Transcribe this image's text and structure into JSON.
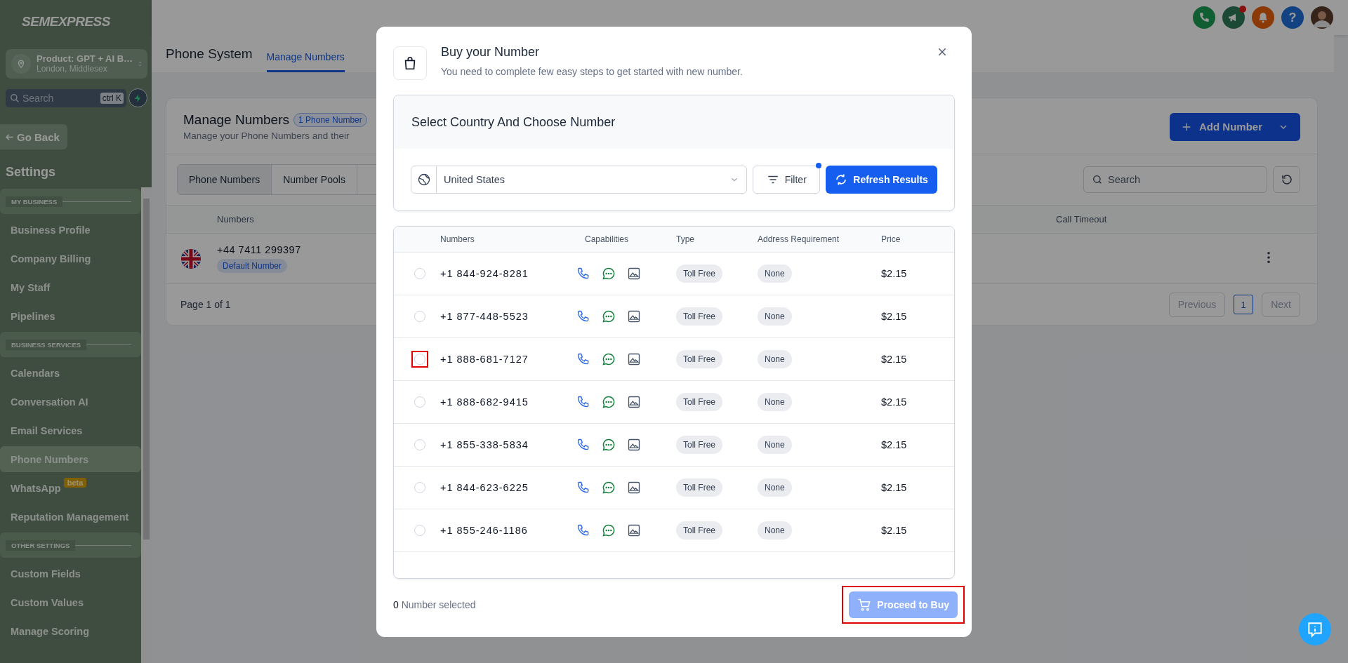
{
  "sidebar": {
    "logo_text": "SEMEXPRESS",
    "location": {
      "title": "Product: GPT + AI B…",
      "subtitle": "London, Middlesex"
    },
    "search": {
      "placeholder": "Search",
      "shortcut": "ctrl K"
    },
    "back": "Go Back",
    "heading": "Settings",
    "groups": [
      {
        "title": "MY BUSINESS",
        "items": [
          {
            "label": "Business Profile",
            "selected": false
          },
          {
            "label": "Company Billing",
            "selected": false
          },
          {
            "label": "My Staff",
            "selected": false
          },
          {
            "label": "Pipelines",
            "selected": false
          }
        ]
      },
      {
        "title": "BUSINESS SERVICES",
        "items": [
          {
            "label": "Calendars",
            "selected": false
          },
          {
            "label": "Conversation AI",
            "selected": false
          },
          {
            "label": "Email Services",
            "selected": false
          },
          {
            "label": "Phone Numbers",
            "selected": true
          },
          {
            "label": "WhatsApp",
            "selected": false,
            "badge": "beta"
          },
          {
            "label": "Reputation Management",
            "selected": false
          }
        ]
      },
      {
        "title": "OTHER SETTINGS",
        "items": [
          {
            "label": "Custom Fields",
            "selected": false
          },
          {
            "label": "Custom Values",
            "selected": false
          },
          {
            "label": "Manage Scoring",
            "selected": false
          }
        ]
      }
    ]
  },
  "topbar": {
    "actions": [
      {
        "kind": "phone"
      },
      {
        "kind": "megaphone",
        "alert": true
      },
      {
        "kind": "bell"
      },
      {
        "kind": "help",
        "label": "?"
      },
      {
        "kind": "avatar"
      }
    ]
  },
  "page": {
    "title": "Phone System",
    "tabs": [
      {
        "label": "Manage Numbers",
        "selected": true
      }
    ]
  },
  "card": {
    "title": "Manage Numbers",
    "count_badge": "1 Phone Number",
    "subtitle": "Manage your Phone Numbers and their",
    "add_button": "Add Number",
    "tabs": [
      {
        "label": "Phone Numbers",
        "selected": true
      },
      {
        "label": "Number Pools",
        "selected": false
      }
    ],
    "search": {
      "placeholder": "Search"
    },
    "columns": {
      "numbers": "Numbers",
      "call_timeout": "Call Timeout"
    },
    "rows": [
      {
        "number": "+44 7411 299397",
        "badge": "Default Number"
      }
    ],
    "pagination": {
      "summary": "Page 1 of 1",
      "previous": "Previous",
      "pages": [
        {
          "label": "1",
          "selected": true
        }
      ],
      "next": "Next"
    }
  },
  "modal": {
    "title": "Buy your Number",
    "subtitle": "You need to complete few easy steps to get started with new number.",
    "section_title": "Select Country And Choose Number",
    "country": "United States",
    "filter": {
      "label": "Filter",
      "active": true
    },
    "refresh": "Refresh Results",
    "columns": [
      "Numbers",
      "Capabilities",
      "Type",
      "Address Requirement",
      "Price"
    ],
    "rows": [
      {
        "number": "+1 844-924-8281",
        "capabilities": [
          {
            "kind": "voice"
          },
          {
            "kind": "sms"
          },
          {
            "kind": "mms"
          }
        ],
        "type": "Toll Free",
        "address": "None",
        "price": "$2.15",
        "selected": false
      },
      {
        "number": "+1 877-448-5523",
        "capabilities": [
          {
            "kind": "voice"
          },
          {
            "kind": "sms"
          },
          {
            "kind": "mms"
          }
        ],
        "type": "Toll Free",
        "address": "None",
        "price": "$2.15",
        "selected": false
      },
      {
        "number": "+1 888-681-7127",
        "capabilities": [
          {
            "kind": "voice"
          },
          {
            "kind": "sms"
          },
          {
            "kind": "mms"
          }
        ],
        "type": "Toll Free",
        "address": "None",
        "price": "$2.15",
        "selected": false,
        "highlighted": true
      },
      {
        "number": "+1 888-682-9415",
        "capabilities": [
          {
            "kind": "voice"
          },
          {
            "kind": "sms"
          },
          {
            "kind": "mms"
          }
        ],
        "type": "Toll Free",
        "address": "None",
        "price": "$2.15",
        "selected": false
      },
      {
        "number": "+1 855-338-5834",
        "capabilities": [
          {
            "kind": "voice"
          },
          {
            "kind": "sms"
          },
          {
            "kind": "mms"
          }
        ],
        "type": "Toll Free",
        "address": "None",
        "price": "$2.15",
        "selected": false
      },
      {
        "number": "+1 844-623-6225",
        "capabilities": [
          {
            "kind": "voice"
          },
          {
            "kind": "sms"
          },
          {
            "kind": "mms"
          }
        ],
        "type": "Toll Free",
        "address": "None",
        "price": "$2.15",
        "selected": false
      },
      {
        "number": "+1 855-246-1186",
        "capabilities": [
          {
            "kind": "voice"
          },
          {
            "kind": "sms"
          },
          {
            "kind": "mms"
          }
        ],
        "type": "Toll Free",
        "address": "None",
        "price": "$2.15",
        "selected": false
      }
    ],
    "selected_count": "0",
    "selected_label": "Number selected",
    "proceed": {
      "label": "Proceed to Buy",
      "disabled": true,
      "highlighted": true
    }
  }
}
